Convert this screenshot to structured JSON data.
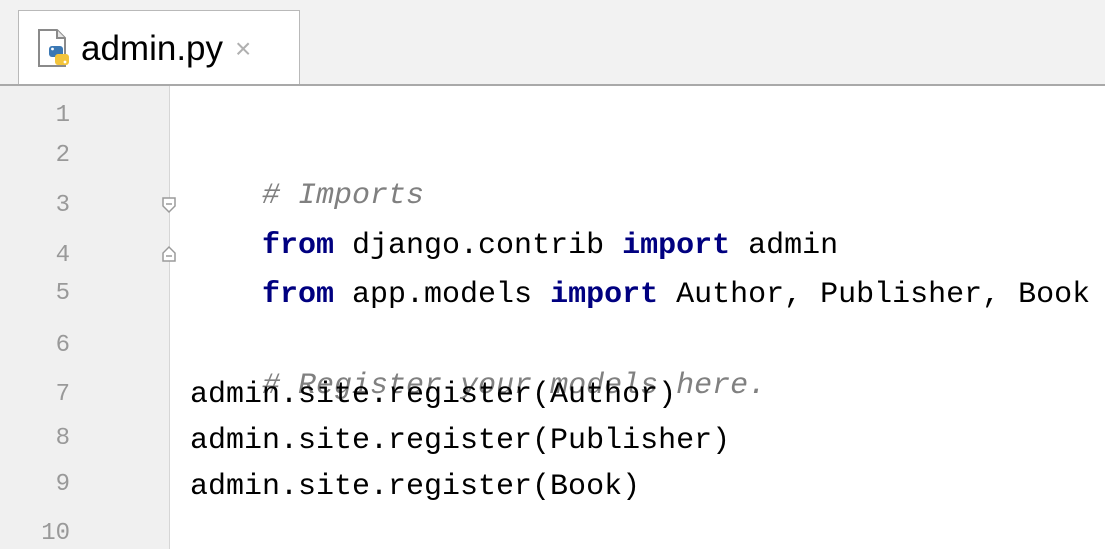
{
  "tab": {
    "filename": "admin.py",
    "close_glyph": "×",
    "icon": "python-file-icon"
  },
  "editor": {
    "line_numbers": [
      "1",
      "2",
      "3",
      "4",
      "5",
      "6",
      "7",
      "8",
      "9",
      "10"
    ],
    "lines": {
      "l2_comment": "# Imports",
      "l3_kw1": "from",
      "l3_mid": " django.contrib ",
      "l3_kw2": "import",
      "l3_end": " admin",
      "l4_kw1": "from",
      "l4_mid": " app.models ",
      "l4_kw2": "import",
      "l4_end": " Author, Publisher, Book",
      "l6_comment": "# Register your models here.",
      "l7": "admin.site.register(Author)",
      "l8": "admin.site.register(Publisher)",
      "l9": "admin.site.register(Book)"
    }
  },
  "colors": {
    "keyword": "#000080",
    "comment": "#808080",
    "line_number": "#999999",
    "gutter_bg": "#f0f0f0"
  }
}
